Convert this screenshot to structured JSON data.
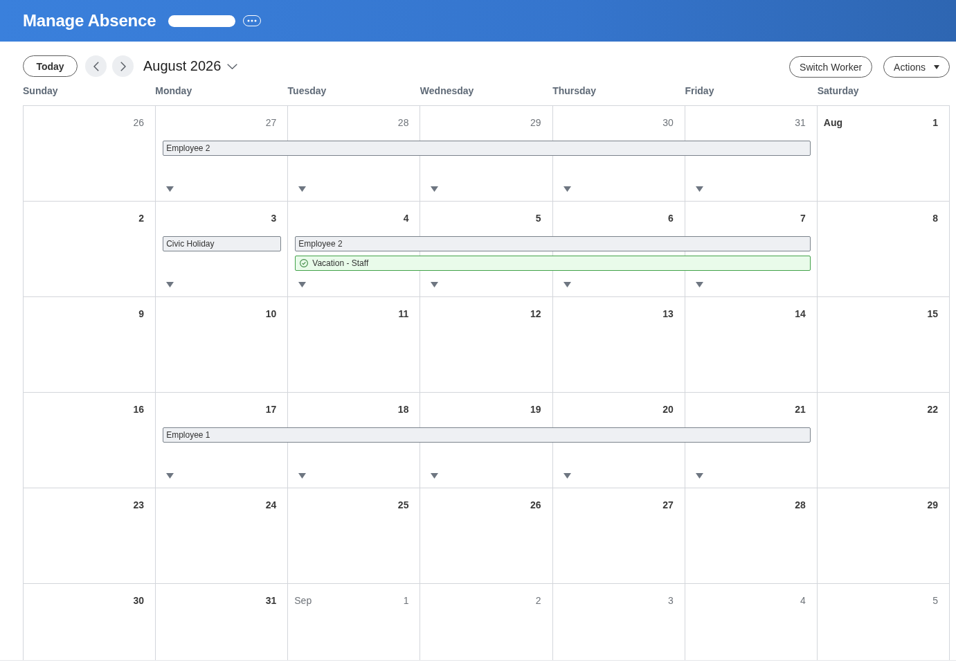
{
  "header": {
    "title": "Manage Absence"
  },
  "toolbar": {
    "today": "Today",
    "month": "August 2026",
    "buttons": [
      {
        "label": "Switch Worker",
        "kind": "plain"
      },
      {
        "label": "Actions",
        "kind": "menu"
      }
    ]
  },
  "calendar": {
    "weekdays": [
      "Sunday",
      "Monday",
      "Tuesday",
      "Wednesday",
      "Thursday",
      "Friday",
      "Saturday"
    ],
    "weeks": [
      {
        "days": [
          {
            "number": "26",
            "outside_month": true,
            "expandable": false
          },
          {
            "number": "27",
            "outside_month": true,
            "expandable": true
          },
          {
            "number": "28",
            "outside_month": true,
            "expandable": true
          },
          {
            "number": "29",
            "outside_month": true,
            "expandable": true
          },
          {
            "number": "30",
            "outside_month": true,
            "expandable": true
          },
          {
            "number": "31",
            "outside_month": true,
            "expandable": true
          },
          {
            "month": "Aug",
            "number": "1",
            "outside_month": false,
            "expandable": false
          }
        ],
        "event_rows": [
          {
            "slots": [
              {
                "kind": "empty"
              },
              {
                "kind": "worker",
                "label": "Employee 2"
              },
              {
                "kind": "continue"
              },
              {
                "kind": "continue"
              },
              {
                "kind": "continue"
              },
              {
                "kind": "continue"
              },
              {
                "kind": "empty"
              }
            ]
          }
        ]
      },
      {
        "days": [
          {
            "number": "2",
            "outside_month": false,
            "expandable": false
          },
          {
            "number": "3",
            "outside_month": false,
            "expandable": true
          },
          {
            "number": "4",
            "outside_month": false,
            "expandable": true
          },
          {
            "number": "5",
            "outside_month": false,
            "expandable": true
          },
          {
            "number": "6",
            "outside_month": false,
            "expandable": true
          },
          {
            "number": "7",
            "outside_month": false,
            "expandable": true
          },
          {
            "number": "8",
            "outside_month": false,
            "expandable": false
          }
        ],
        "event_rows": [
          {
            "slots": [
              {
                "kind": "empty"
              },
              {
                "kind": "holiday",
                "label": "Civic Holiday"
              },
              {
                "kind": "worker",
                "label": "Employee 2"
              },
              {
                "kind": "continue"
              },
              {
                "kind": "continue"
              },
              {
                "kind": "continue"
              },
              {
                "kind": "empty"
              }
            ]
          },
          {
            "slots": [
              {
                "kind": "empty"
              },
              {
                "kind": "empty"
              },
              {
                "kind": "time_off",
                "label": "Vacation - Staff"
              },
              {
                "kind": "continue"
              },
              {
                "kind": "continue"
              },
              {
                "kind": "continue"
              },
              {
                "kind": "empty"
              }
            ]
          }
        ]
      },
      {
        "days": [
          {
            "number": "9",
            "outside_month": false,
            "expandable": false
          },
          {
            "number": "10",
            "outside_month": false,
            "expandable": false
          },
          {
            "number": "11",
            "outside_month": false,
            "expandable": false
          },
          {
            "number": "12",
            "outside_month": false,
            "expandable": false
          },
          {
            "number": "13",
            "outside_month": false,
            "expandable": false
          },
          {
            "number": "14",
            "outside_month": false,
            "expandable": false
          },
          {
            "number": "15",
            "outside_month": false,
            "expandable": false
          }
        ]
      },
      {
        "days": [
          {
            "number": "16",
            "outside_month": false,
            "expandable": false
          },
          {
            "number": "17",
            "outside_month": false,
            "expandable": true
          },
          {
            "number": "18",
            "outside_month": false,
            "expandable": true
          },
          {
            "number": "19",
            "outside_month": false,
            "expandable": true
          },
          {
            "number": "20",
            "outside_month": false,
            "expandable": true
          },
          {
            "number": "21",
            "outside_month": false,
            "expandable": true
          },
          {
            "number": "22",
            "outside_month": false,
            "expandable": false
          }
        ],
        "event_rows": [
          {
            "slots": [
              {
                "kind": "empty"
              },
              {
                "kind": "worker",
                "label": "Employee 1"
              },
              {
                "kind": "continue"
              },
              {
                "kind": "continue"
              },
              {
                "kind": "continue"
              },
              {
                "kind": "continue"
              },
              {
                "kind": "empty"
              }
            ]
          }
        ]
      },
      {
        "days": [
          {
            "number": "23",
            "outside_month": false,
            "expandable": false
          },
          {
            "number": "24",
            "outside_month": false,
            "expandable": false
          },
          {
            "number": "25",
            "outside_month": false,
            "expandable": false
          },
          {
            "number": "26",
            "outside_month": false,
            "expandable": false
          },
          {
            "number": "27",
            "outside_month": false,
            "expandable": false
          },
          {
            "number": "28",
            "outside_month": false,
            "expandable": false
          },
          {
            "number": "29",
            "outside_month": false,
            "expandable": false
          }
        ]
      },
      {
        "days": [
          {
            "number": "30",
            "outside_month": false,
            "expandable": false
          },
          {
            "number": "31",
            "outside_month": false,
            "expandable": false
          },
          {
            "month": "Sep",
            "number": "1",
            "outside_month": true,
            "expandable": false
          },
          {
            "number": "2",
            "outside_month": true,
            "expandable": false
          },
          {
            "number": "3",
            "outside_month": true,
            "expandable": false
          },
          {
            "number": "4",
            "outside_month": true,
            "expandable": false
          },
          {
            "number": "5",
            "outside_month": true,
            "expandable": false
          }
        ]
      }
    ]
  }
}
